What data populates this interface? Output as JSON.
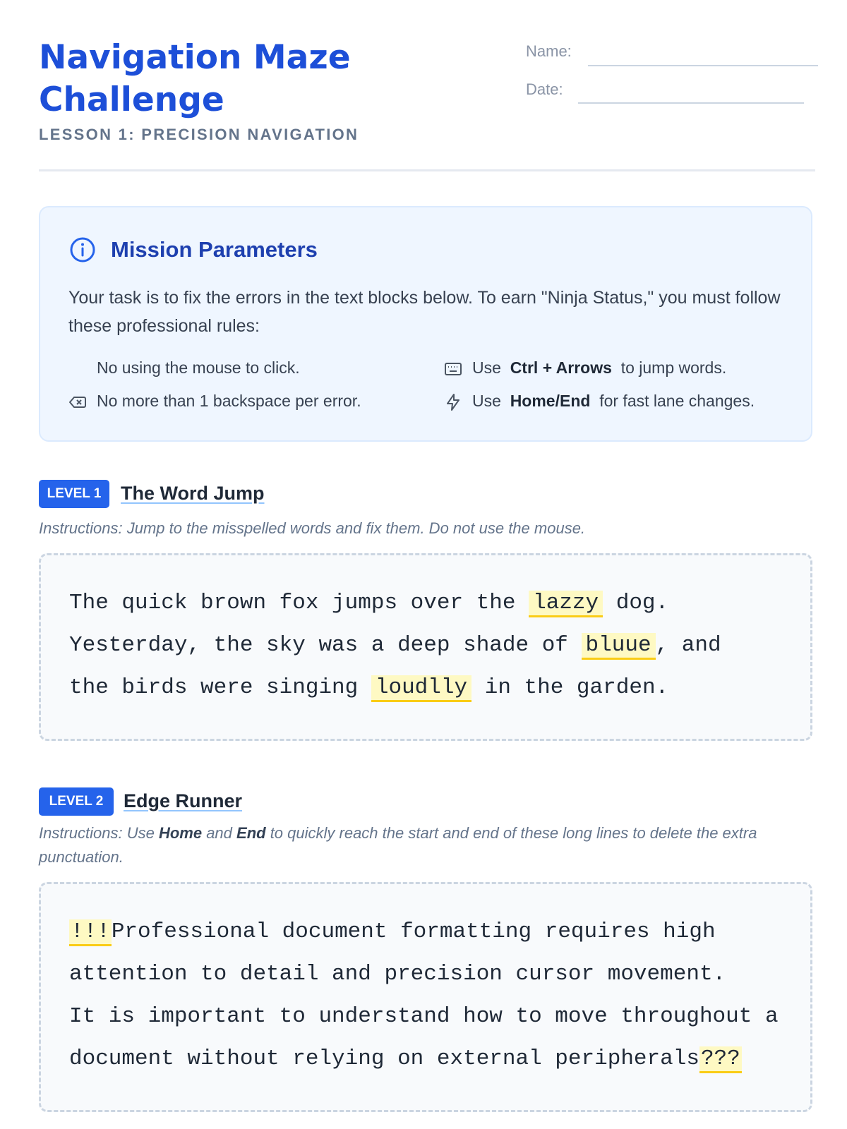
{
  "header": {
    "title": "Navigation Maze Challenge",
    "subtitle": "LESSON 1: PRECISION NAVIGATION",
    "name_label": "Name:",
    "date_label": "Date:"
  },
  "mission": {
    "icon": "info-icon",
    "title": "Mission Parameters",
    "text": "Your task is to fix the errors in the text blocks below. To earn \"Ninja Status,\" you must follow these professional rules:",
    "rules": [
      {
        "icon": "none",
        "text": "No using the mouse to click."
      },
      {
        "icon": "backspace-icon",
        "text": "No more than 1 backspace per error."
      },
      {
        "icon": "keyboard-icon",
        "pre": "Use",
        "bold": "Ctrl + Arrows",
        "post": "to jump words."
      },
      {
        "icon": "lightning-icon",
        "pre": "Use",
        "bold": "Home/End",
        "post": "for fast lane changes."
      }
    ]
  },
  "level1": {
    "badge": "LEVEL 1",
    "title": "The Word Jump",
    "instructions": "Instructions: Jump to the misspelled words and fix them. Do not use the mouse.",
    "lines": [
      {
        "pre": "The quick brown fox jumps over the ",
        "hl": "lazzy",
        "post": " dog."
      },
      {
        "pre": "Yesterday, the sky was a deep shade of ",
        "hl": "bluue",
        "post": ", and"
      },
      {
        "pre": "the birds were singing ",
        "hl": "loudlly",
        "post": " in the garden."
      }
    ]
  },
  "level2": {
    "badge": "LEVEL 2",
    "title": "Edge Runner",
    "instr_pre": "Instructions: Use ",
    "instr_b1": "Home",
    "instr_mid": " and ",
    "instr_b2": "End",
    "instr_post": " to quickly reach the start and end of these long lines to delete the extra punctuation.",
    "line1_hl": "!!!",
    "line1_text": "Professional document formatting requires high",
    "line2": "attention to detail and precision cursor movement.",
    "line3": "It is important to understand how to move throughout a",
    "line4_text": "document without relying on external peripherals",
    "line4_hl": "???"
  },
  "colors": {
    "accent": "#1d4fd8",
    "badge": "#2563eb",
    "highlight": "#fef9c3",
    "highlight_border": "#facc15"
  }
}
